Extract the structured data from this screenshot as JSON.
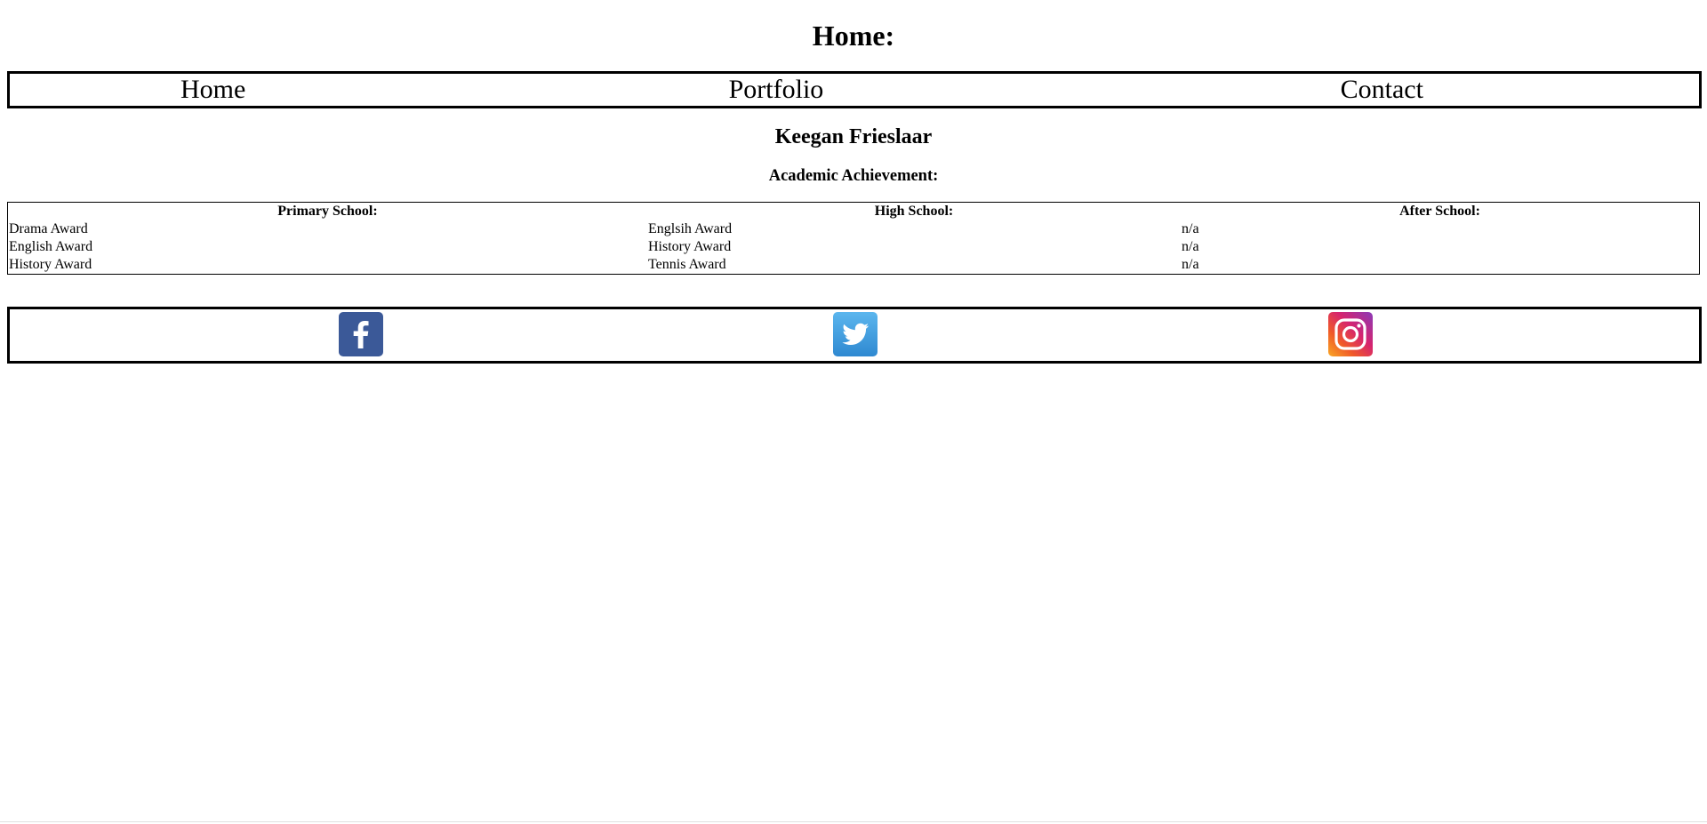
{
  "header": {
    "title": "Home:"
  },
  "nav": {
    "items": [
      {
        "label": "Home"
      },
      {
        "label": "Portfolio"
      },
      {
        "label": "Contact"
      }
    ]
  },
  "profile": {
    "name": "Keegan Frieslaar"
  },
  "achievements": {
    "heading": "Academic Achievement:",
    "columns": [
      "Primary School:",
      "High School:",
      "After School:"
    ],
    "rows": [
      [
        "Drama Award",
        "Englsih Award",
        "n/a"
      ],
      [
        "English Award",
        "History Award",
        "n/a"
      ],
      [
        "History Award",
        "Tennis Award",
        "n/a"
      ]
    ]
  },
  "social": {
    "icons": [
      "facebook-icon",
      "twitter-icon",
      "instagram-icon"
    ],
    "colors": {
      "facebook": "#3b5998",
      "twitter": "#2f89d1",
      "instagram": "#d6246e"
    }
  }
}
